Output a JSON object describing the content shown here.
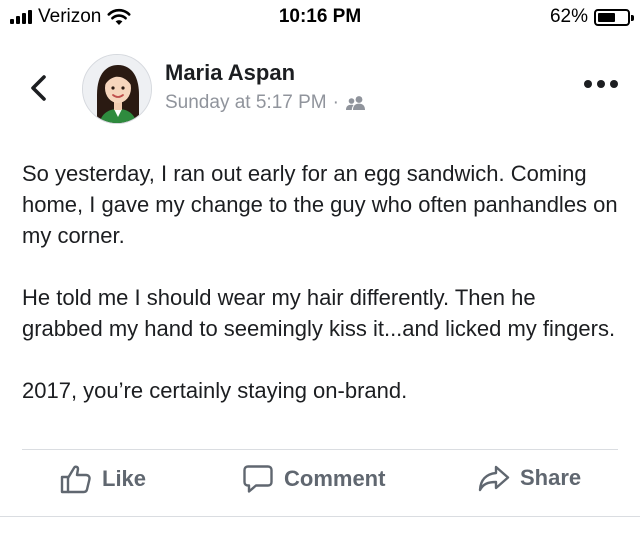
{
  "status_bar": {
    "carrier": "Verizon",
    "time": "10:16 PM",
    "battery_percent_label": "62%",
    "battery_level": 0.62,
    "signal_bars": 4,
    "icons": [
      "signal-bars-icon",
      "wifi-icon",
      "battery-icon"
    ]
  },
  "post": {
    "author": "Maria Aspan",
    "timestamp": "Sunday at 5:17 PM",
    "separator": "·",
    "audience_icon": "friends-icon",
    "paragraphs": [
      "So yesterday, I ran out early for an egg sandwich. Coming home, I gave my change to the guy who often panhandles on my corner.",
      "He told me I should wear my hair differently. Then he grabbed my hand to seemingly kiss it...and licked my fingers.",
      "2017, you’re certainly staying on-brand."
    ]
  },
  "actions": {
    "like_label": "Like",
    "comment_label": "Comment",
    "share_label": "Share"
  },
  "colors": {
    "text": "#1c1e21",
    "meta": "#90949c",
    "action": "#606770",
    "divider": "#dadde1",
    "avatar_shirt": "#2e8b3e"
  }
}
